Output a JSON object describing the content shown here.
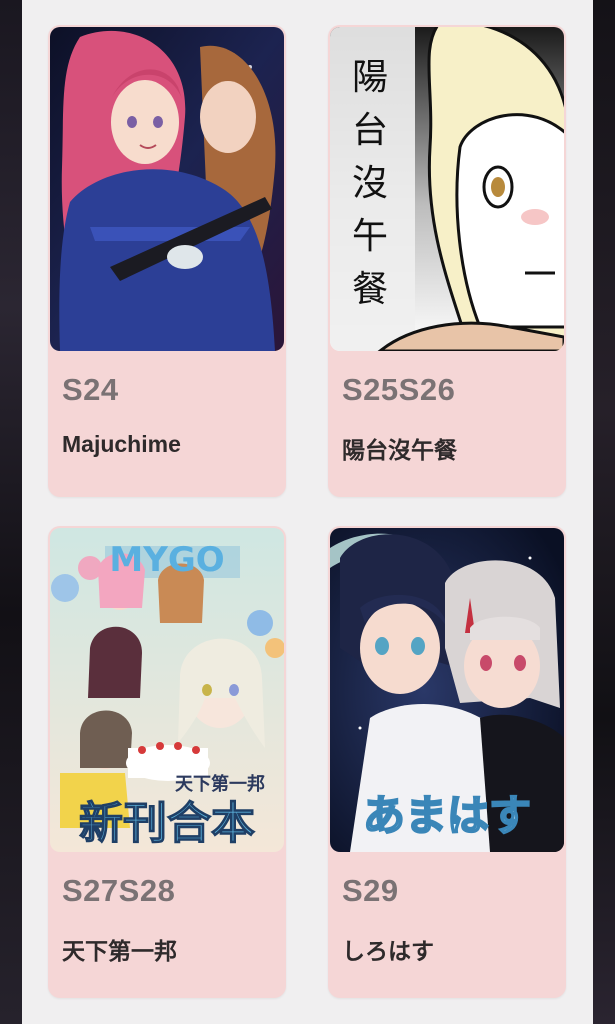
{
  "cards": [
    {
      "code": "S24",
      "title": "Majuchime",
      "cover_icon": "anime-illustration-cover"
    },
    {
      "code": "S25S26",
      "title": "陽台沒午餐",
      "cover_icon": "manga-comic-cover",
      "cover_text": "陽台沒午餐"
    },
    {
      "code": "S27S28",
      "title": "天下第一邦",
      "cover_icon": "group-illustration-cover",
      "cover_text": {
        "banner": "MYGO",
        "sub": "天下第一邦",
        "main": "新刊合本"
      }
    },
    {
      "code": "S29",
      "title": "しろはす",
      "cover_icon": "duo-illustration-cover",
      "cover_text": "あまはす"
    }
  ]
}
